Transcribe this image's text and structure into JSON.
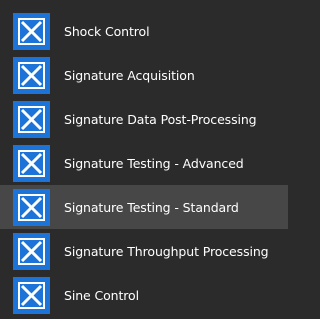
{
  "list": {
    "items": [
      {
        "label": "Shock Control",
        "icon": "x-box-icon",
        "selected": false
      },
      {
        "label": "Signature Acquisition",
        "icon": "x-box-icon",
        "selected": false
      },
      {
        "label": "Signature Data Post-Processing",
        "icon": "x-box-icon",
        "selected": false
      },
      {
        "label": "Signature Testing - Advanced",
        "icon": "x-box-icon",
        "selected": false
      },
      {
        "label": "Signature Testing - Standard",
        "icon": "x-box-icon",
        "selected": true
      },
      {
        "label": "Signature Throughput Processing",
        "icon": "x-box-icon",
        "selected": false
      },
      {
        "label": "Sine Control",
        "icon": "x-box-icon",
        "selected": false
      }
    ]
  },
  "colors": {
    "background": "#2b2b2b",
    "selected_background": "#474747",
    "icon_blue": "#1d74d8",
    "icon_border": "#ffffff",
    "text": "#ffffff"
  }
}
